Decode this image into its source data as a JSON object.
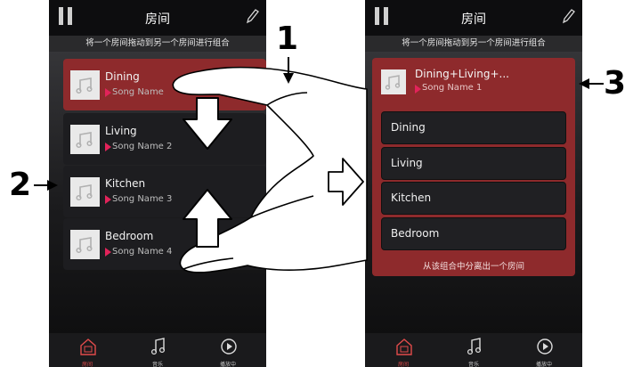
{
  "left_screen": {
    "title": "房间",
    "subtitle": "将一个房间拖动到另一个房间进行组合",
    "rooms": [
      {
        "name": "Dining",
        "song": "Song Name"
      },
      {
        "name": "Living",
        "song": "Song Name 2"
      },
      {
        "name": "Kitchen",
        "song": "Song Name 3"
      },
      {
        "name": "Bedroom",
        "song": "Song Name 4"
      }
    ],
    "tabs": [
      {
        "label": "房间",
        "icon": "home-icon"
      },
      {
        "label": "音乐",
        "icon": "music-note-icon"
      },
      {
        "label": "播放中",
        "icon": "play-circle-icon"
      }
    ]
  },
  "right_screen": {
    "title": "房间",
    "subtitle": "将一个房间拖动到另一个房间进行组合",
    "group_name": "Dining+Living+...",
    "group_song": "Song Name 1",
    "members": [
      "Dining",
      "Living",
      "Kitchen",
      "Bedroom"
    ],
    "separate_label": "从该组合中分离出一个房间",
    "tabs": [
      {
        "label": "房间",
        "icon": "home-icon"
      },
      {
        "label": "音乐",
        "icon": "music-note-icon"
      },
      {
        "label": "播放中",
        "icon": "play-circle-icon"
      }
    ]
  },
  "callouts": {
    "one": "1",
    "two": "2",
    "three": "3"
  },
  "colors": {
    "selected_card": "#8e2a2c",
    "play_mark": "#e2235a",
    "active_tab": "#e14b4b"
  }
}
